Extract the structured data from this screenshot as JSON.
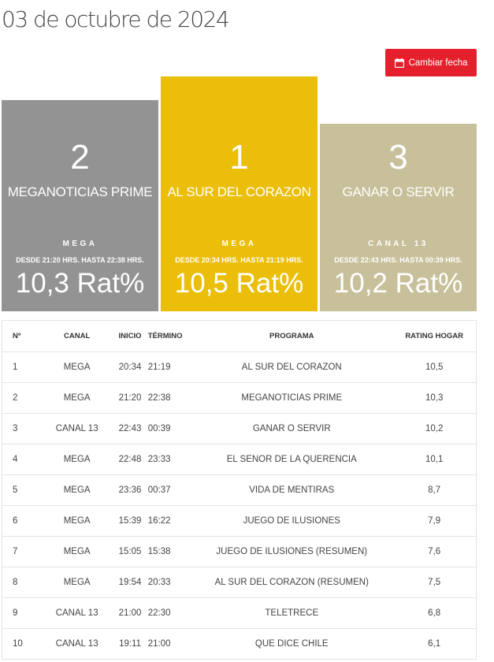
{
  "page_title": "03 de octubre de 2024",
  "change_date_button": {
    "label": "Cambiar fecha",
    "icon": "calendar-icon"
  },
  "podium": [
    {
      "rank": "2",
      "program": "MEGANOTICIAS PRIME",
      "channel": "MEGA",
      "time": "DESDE 21:20 HRS. HASTA 22:38 HRS.",
      "rating": "10,3 Rat%",
      "color": "#939393"
    },
    {
      "rank": "1",
      "program": "AL SUR DEL CORAZON",
      "channel": "MEGA",
      "time": "DESDE 20:34 HRS. HASTA 21:19 HRS.",
      "rating": "10,5 Rat%",
      "color": "#ebbe0a"
    },
    {
      "rank": "3",
      "program": "GANAR O SERVIR",
      "channel": "CANAL 13",
      "time": "DESDE 22:43 HRS. HASTA 00:39 HRS.",
      "rating": "10,2 Rat%",
      "color": "#c8c09a"
    }
  ],
  "table": {
    "headers": {
      "n": "Nº",
      "canal": "CANAL",
      "inicio": "INICIO",
      "termino": "TÉRMINO",
      "programa": "PROGRAMA",
      "rating": "RATING HOGAR"
    },
    "rows": [
      {
        "n": "1",
        "canal": "MEGA",
        "inicio": "20:34",
        "termino": "21:19",
        "programa": "AL SUR DEL CORAZON",
        "rating": "10,5"
      },
      {
        "n": "2",
        "canal": "MEGA",
        "inicio": "21:20",
        "termino": "22:38",
        "programa": "MEGANOTICIAS PRIME",
        "rating": "10,3"
      },
      {
        "n": "3",
        "canal": "CANAL 13",
        "inicio": "22:43",
        "termino": "00:39",
        "programa": "GANAR O SERVIR",
        "rating": "10,2"
      },
      {
        "n": "4",
        "canal": "MEGA",
        "inicio": "22:48",
        "termino": "23:33",
        "programa": "EL SENOR DE LA QUERENCIA",
        "rating": "10,1"
      },
      {
        "n": "5",
        "canal": "MEGA",
        "inicio": "23:36",
        "termino": "00:37",
        "programa": "VIDA DE MENTIRAS",
        "rating": "8,7"
      },
      {
        "n": "6",
        "canal": "MEGA",
        "inicio": "15:39",
        "termino": "16:22",
        "programa": "JUEGO DE ILUSIONES",
        "rating": "7,9"
      },
      {
        "n": "7",
        "canal": "MEGA",
        "inicio": "15:05",
        "termino": "15:38",
        "programa": "JUEGO DE ILUSIONES (RESUMEN)",
        "rating": "7,6"
      },
      {
        "n": "8",
        "canal": "MEGA",
        "inicio": "19:54",
        "termino": "20:33",
        "programa": "AL SUR DEL CORAZON (RESUMEN)",
        "rating": "7,5"
      },
      {
        "n": "9",
        "canal": "CANAL 13",
        "inicio": "21:00",
        "termino": "22:30",
        "programa": "TELETRECE",
        "rating": "6,8"
      },
      {
        "n": "10",
        "canal": "CANAL 13",
        "inicio": "19:11",
        "termino": "21:00",
        "programa": "QUE DICE CHILE",
        "rating": "6,1"
      }
    ]
  }
}
